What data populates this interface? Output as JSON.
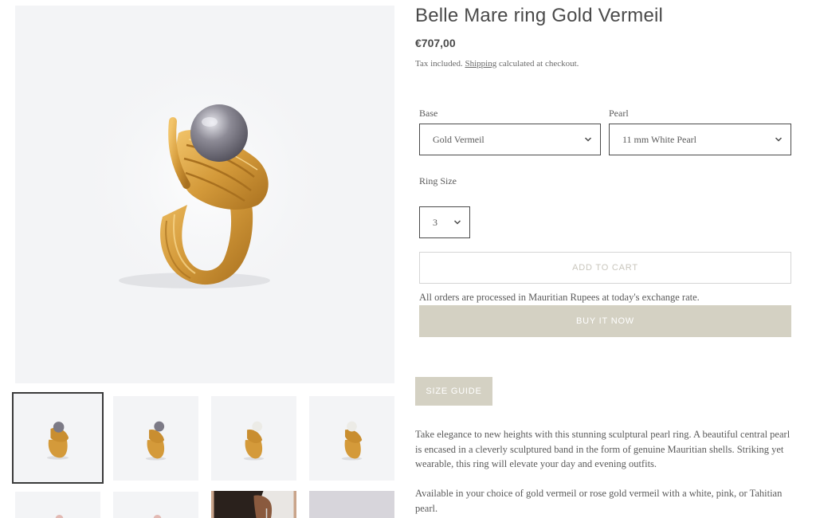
{
  "product": {
    "title": "Belle Mare ring Gold Vermeil",
    "price": "€707,00",
    "tax_prefix": "Tax included. ",
    "tax_link": "Shipping",
    "tax_suffix": " calculated at checkout."
  },
  "options": {
    "base": {
      "label": "Base",
      "value": "Gold Vermeil"
    },
    "pearl": {
      "label": "Pearl",
      "value": "11 mm White Pearl"
    },
    "ring_size": {
      "label": "Ring Size",
      "value": "3"
    }
  },
  "actions": {
    "add_to_cart": "ADD TO CART",
    "note": "All orders are processed in Mauritian Rupees at today's exchange rate.",
    "buy_now": "BUY IT NOW",
    "size_guide": "SIZE GUIDE"
  },
  "description": {
    "paragraph_1": "Take elegance to new heights with this stunning sculptural pearl ring. A beautiful central pearl is encased in a cleverly sculptured band in the form of genuine Mauritian shells. Striking yet wearable, this ring will elevate your day and evening outfits.",
    "paragraph_2": "Available in your choice of gold vermeil or rose gold vermeil with a white, pink, or Tahitian pearl."
  },
  "gallery": {
    "thumbnails": [
      "ring-grey-pearl-front",
      "ring-grey-pearl-side",
      "ring-white-pearl-front",
      "ring-white-pearl-side",
      "ring-pink-pearl-front",
      "ring-pink-pearl-side",
      "model-wearing-earrings",
      "product-photo"
    ]
  },
  "colors": {
    "button_bg": "#d4d1c3",
    "gold": "#d49a3a",
    "image_bg": "#f3f4f6"
  }
}
